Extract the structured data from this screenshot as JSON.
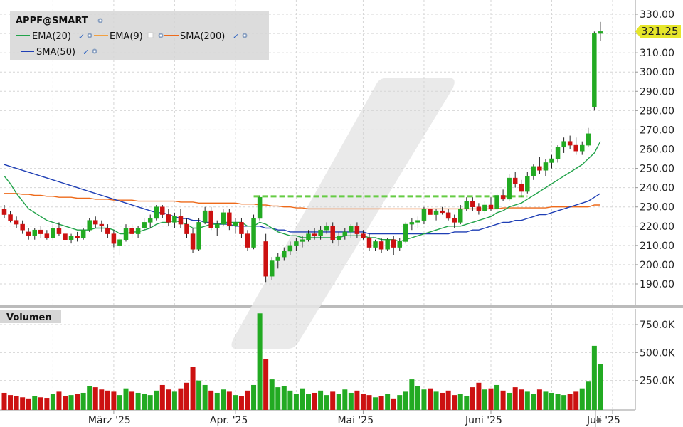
{
  "symbol": "APPF@SMART",
  "last_price": "321.25",
  "volume_title": "Volumen",
  "colors": {
    "up": "#22aa22",
    "down": "#cc1111",
    "ema20": "#22a34a",
    "ema9": "#f2a040",
    "sma200": "#ee6a1a",
    "sma50": "#1f3fb5",
    "trendline": "#66cc44",
    "last_price_bg": "#e6e62a"
  },
  "legend": [
    {
      "label": "EMA(20)",
      "color_key": "ema20",
      "checked": true
    },
    {
      "label": "EMA(9)",
      "color_key": "ema9",
      "checked": false
    },
    {
      "label": "SMA(200)",
      "color_key": "sma200",
      "checked": true
    },
    {
      "label": "SMA(50)",
      "color_key": "sma50",
      "checked": true
    }
  ],
  "chart_data": {
    "type": "candlestick",
    "price_axis": {
      "ticks": [
        "330.00",
        "320.00",
        "310.00",
        "300.00",
        "290.00",
        "280.00",
        "270.00",
        "260.00",
        "250.00",
        "240.00",
        "230.00",
        "220.00",
        "210.00",
        "200.00",
        "190.00"
      ],
      "ylim": [
        183,
        333
      ]
    },
    "volume_axis": {
      "ticks": [
        "750.0K",
        "500.0K",
        "250.0K"
      ],
      "ylim": [
        0,
        900000
      ]
    },
    "x_labels": [
      {
        "label": "März '25",
        "index": 18
      },
      {
        "label": "Apr. '25",
        "index": 38
      },
      {
        "label": "Mai '25",
        "index": 59
      },
      {
        "label": "Juni '25",
        "index": 80
      },
      {
        "label": "Juli '25",
        "index": 100
      }
    ],
    "ohlc": [
      [
        229,
        231,
        224,
        226
      ],
      [
        226,
        228,
        222,
        223
      ],
      [
        223,
        225,
        219,
        221
      ],
      [
        221,
        223,
        216,
        218
      ],
      [
        217,
        219,
        213,
        215
      ],
      [
        215,
        219,
        213,
        218
      ],
      [
        218,
        220,
        214,
        216
      ],
      [
        216,
        218,
        213,
        214
      ],
      [
        214,
        221,
        213,
        219
      ],
      [
        219,
        222,
        215,
        216
      ],
      [
        216,
        218,
        211,
        213
      ],
      [
        213,
        216,
        211,
        215
      ],
      [
        215,
        217,
        212,
        214
      ],
      [
        214,
        219,
        213,
        218
      ],
      [
        218,
        224,
        217,
        223
      ],
      [
        223,
        225,
        219,
        221
      ],
      [
        221,
        223,
        217,
        220
      ],
      [
        219,
        221,
        214,
        216
      ],
      [
        216,
        218,
        209,
        211
      ],
      [
        210,
        214,
        205,
        213
      ],
      [
        213,
        221,
        212,
        219
      ],
      [
        219,
        221,
        214,
        216
      ],
      [
        216,
        220,
        214,
        219
      ],
      [
        219,
        224,
        218,
        222
      ],
      [
        222,
        226,
        219,
        224
      ],
      [
        224,
        231,
        223,
        230
      ],
      [
        230,
        231,
        224,
        226
      ],
      [
        226,
        229,
        220,
        222
      ],
      [
        222,
        227,
        219,
        225
      ],
      [
        225,
        229,
        219,
        221
      ],
      [
        221,
        224,
        214,
        216
      ],
      [
        216,
        219,
        206,
        208
      ],
      [
        208,
        224,
        207,
        222
      ],
      [
        222,
        230,
        221,
        228
      ],
      [
        228,
        230,
        218,
        219
      ],
      [
        219,
        223,
        215,
        221
      ],
      [
        221,
        229,
        220,
        227
      ],
      [
        227,
        229,
        218,
        220
      ],
      [
        220,
        224,
        216,
        222
      ],
      [
        222,
        224,
        214,
        216
      ],
      [
        216,
        218,
        207,
        209
      ],
      [
        209,
        226,
        208,
        224
      ],
      [
        224,
        236,
        223,
        235
      ],
      [
        212,
        216,
        191,
        194
      ],
      [
        194,
        204,
        192,
        202
      ],
      [
        202,
        206,
        198,
        204
      ],
      [
        204,
        209,
        202,
        207
      ],
      [
        207,
        212,
        205,
        210
      ],
      [
        210,
        214,
        207,
        212
      ],
      [
        212,
        215,
        209,
        213
      ],
      [
        213,
        218,
        212,
        216
      ],
      [
        216,
        219,
        213,
        215
      ],
      [
        215,
        220,
        213,
        218
      ],
      [
        218,
        222,
        216,
        220
      ],
      [
        220,
        222,
        211,
        213
      ],
      [
        213,
        217,
        210,
        215
      ],
      [
        215,
        219,
        213,
        217
      ],
      [
        217,
        221,
        214,
        220
      ],
      [
        220,
        222,
        214,
        216
      ],
      [
        216,
        218,
        213,
        214
      ],
      [
        214,
        216,
        207,
        209
      ],
      [
        209,
        213,
        207,
        212
      ],
      [
        212,
        214,
        206,
        208
      ],
      [
        208,
        214,
        207,
        213
      ],
      [
        213,
        215,
        205,
        209
      ],
      [
        209,
        214,
        207,
        212
      ],
      [
        212,
        222,
        211,
        221
      ],
      [
        221,
        224,
        218,
        222
      ],
      [
        222,
        225,
        219,
        223
      ],
      [
        223,
        230,
        221,
        229
      ],
      [
        229,
        231,
        224,
        226
      ],
      [
        226,
        229,
        223,
        228
      ],
      [
        228,
        230,
        226,
        227
      ],
      [
        227,
        229,
        223,
        224
      ],
      [
        224,
        226,
        219,
        222
      ],
      [
        222,
        231,
        221,
        229
      ],
      [
        229,
        235,
        228,
        233
      ],
      [
        233,
        235,
        228,
        230
      ],
      [
        230,
        232,
        226,
        228
      ],
      [
        228,
        233,
        226,
        231
      ],
      [
        231,
        235,
        228,
        229
      ],
      [
        229,
        237,
        228,
        236
      ],
      [
        236,
        239,
        233,
        234
      ],
      [
        234,
        247,
        233,
        245
      ],
      [
        245,
        248,
        240,
        242
      ],
      [
        242,
        244,
        235,
        238
      ],
      [
        238,
        248,
        237,
        246
      ],
      [
        246,
        252,
        244,
        251
      ],
      [
        251,
        256,
        247,
        249
      ],
      [
        249,
        255,
        246,
        253
      ],
      [
        253,
        257,
        250,
        255
      ],
      [
        255,
        262,
        253,
        261
      ],
      [
        261,
        266,
        258,
        264
      ],
      [
        264,
        267,
        260,
        262
      ],
      [
        262,
        266,
        257,
        259
      ],
      [
        259,
        264,
        257,
        262
      ],
      [
        262,
        271,
        261,
        268
      ],
      [
        282,
        321,
        280,
        320
      ],
      [
        320,
        326,
        316,
        321
      ]
    ],
    "volume": [
      140000,
      120000,
      110000,
      100000,
      90000,
      110000,
      100000,
      95000,
      130000,
      150000,
      110000,
      120000,
      130000,
      140000,
      200000,
      190000,
      170000,
      160000,
      150000,
      120000,
      180000,
      150000,
      140000,
      130000,
      120000,
      160000,
      210000,
      170000,
      150000,
      180000,
      230000,
      370000,
      250000,
      210000,
      160000,
      140000,
      170000,
      150000,
      120000,
      110000,
      160000,
      210000,
      850000,
      440000,
      260000,
      190000,
      200000,
      160000,
      130000,
      180000,
      130000,
      140000,
      160000,
      120000,
      150000,
      130000,
      170000,
      140000,
      160000,
      130000,
      120000,
      100000,
      110000,
      130000,
      90000,
      120000,
      150000,
      260000,
      200000,
      170000,
      180000,
      150000,
      140000,
      160000,
      120000,
      130000,
      110000,
      190000,
      230000,
      170000,
      180000,
      210000,
      160000,
      140000,
      190000,
      170000,
      150000,
      130000,
      170000,
      150000,
      140000,
      130000,
      120000,
      130000,
      150000,
      180000,
      240000,
      560000,
      400000
    ],
    "ema20": [
      246,
      242,
      237,
      233,
      229,
      227,
      225,
      223,
      222,
      221,
      220,
      219,
      218,
      218,
      218,
      219,
      219,
      219,
      218,
      216,
      216,
      217,
      217,
      218,
      219,
      221,
      222,
      222,
      223,
      222,
      221,
      219,
      219,
      220,
      221,
      221,
      222,
      222,
      222,
      222,
      220,
      220,
      222,
      221,
      219,
      217,
      216,
      215,
      215,
      214,
      214,
      214,
      214,
      214,
      214,
      214,
      215,
      215,
      215,
      215,
      214,
      214,
      213,
      213,
      213,
      212,
      213,
      214,
      215,
      216,
      217,
      218,
      219,
      220,
      220,
      220,
      221,
      222,
      223,
      224,
      225,
      227,
      228,
      230,
      231,
      232,
      234,
      236,
      238,
      240,
      242,
      244,
      246,
      248,
      250,
      252,
      255,
      258,
      264
    ],
    "sma200": [
      237,
      237,
      237,
      236.5,
      236.5,
      236,
      236,
      235.5,
      235.5,
      235,
      235,
      235,
      234.5,
      234.5,
      234.5,
      234,
      234,
      234,
      233.5,
      233.5,
      233.5,
      233.5,
      233,
      233,
      233,
      233,
      233,
      233,
      233,
      232.5,
      232.5,
      232.5,
      232,
      232,
      232,
      232,
      232,
      232,
      232,
      231.5,
      231.5,
      231.5,
      231,
      231,
      230.5,
      230.5,
      230,
      230,
      229.5,
      229.5,
      229,
      229,
      229,
      229,
      229,
      229,
      229,
      229,
      229,
      229,
      229,
      229,
      229,
      229,
      229,
      229,
      229,
      229,
      229,
      229,
      229,
      229,
      229,
      229,
      229,
      229,
      229,
      229,
      229,
      229,
      229,
      229,
      229.5,
      229.5,
      229.5,
      229.5,
      229.5,
      229.5,
      229.5,
      229.5,
      230,
      230,
      230,
      230,
      230,
      230,
      230,
      231,
      231
    ],
    "sma50": [
      252,
      251,
      250,
      249,
      248,
      247,
      246,
      245,
      244,
      243,
      242,
      241,
      240,
      239,
      238,
      237,
      236,
      235,
      234,
      233,
      232,
      231,
      230,
      229,
      228,
      227,
      227,
      226,
      225,
      224,
      224,
      223,
      223,
      222,
      222,
      221,
      221,
      221,
      220,
      220,
      220,
      220,
      220,
      219,
      219,
      218,
      218,
      217,
      217,
      217,
      217,
      217,
      217,
      217,
      217,
      217,
      217,
      217,
      217,
      217,
      216,
      216,
      216,
      216,
      216,
      216,
      216,
      216,
      216,
      216,
      216,
      216,
      216,
      216,
      217,
      217,
      217,
      218,
      218,
      219,
      220,
      221,
      222,
      222,
      223,
      223,
      224,
      225,
      226,
      226,
      227,
      228,
      229,
      230,
      231,
      232,
      233,
      235,
      237
    ],
    "trendline": {
      "value": 235.5,
      "from_index": 41,
      "to_index": 86
    }
  }
}
